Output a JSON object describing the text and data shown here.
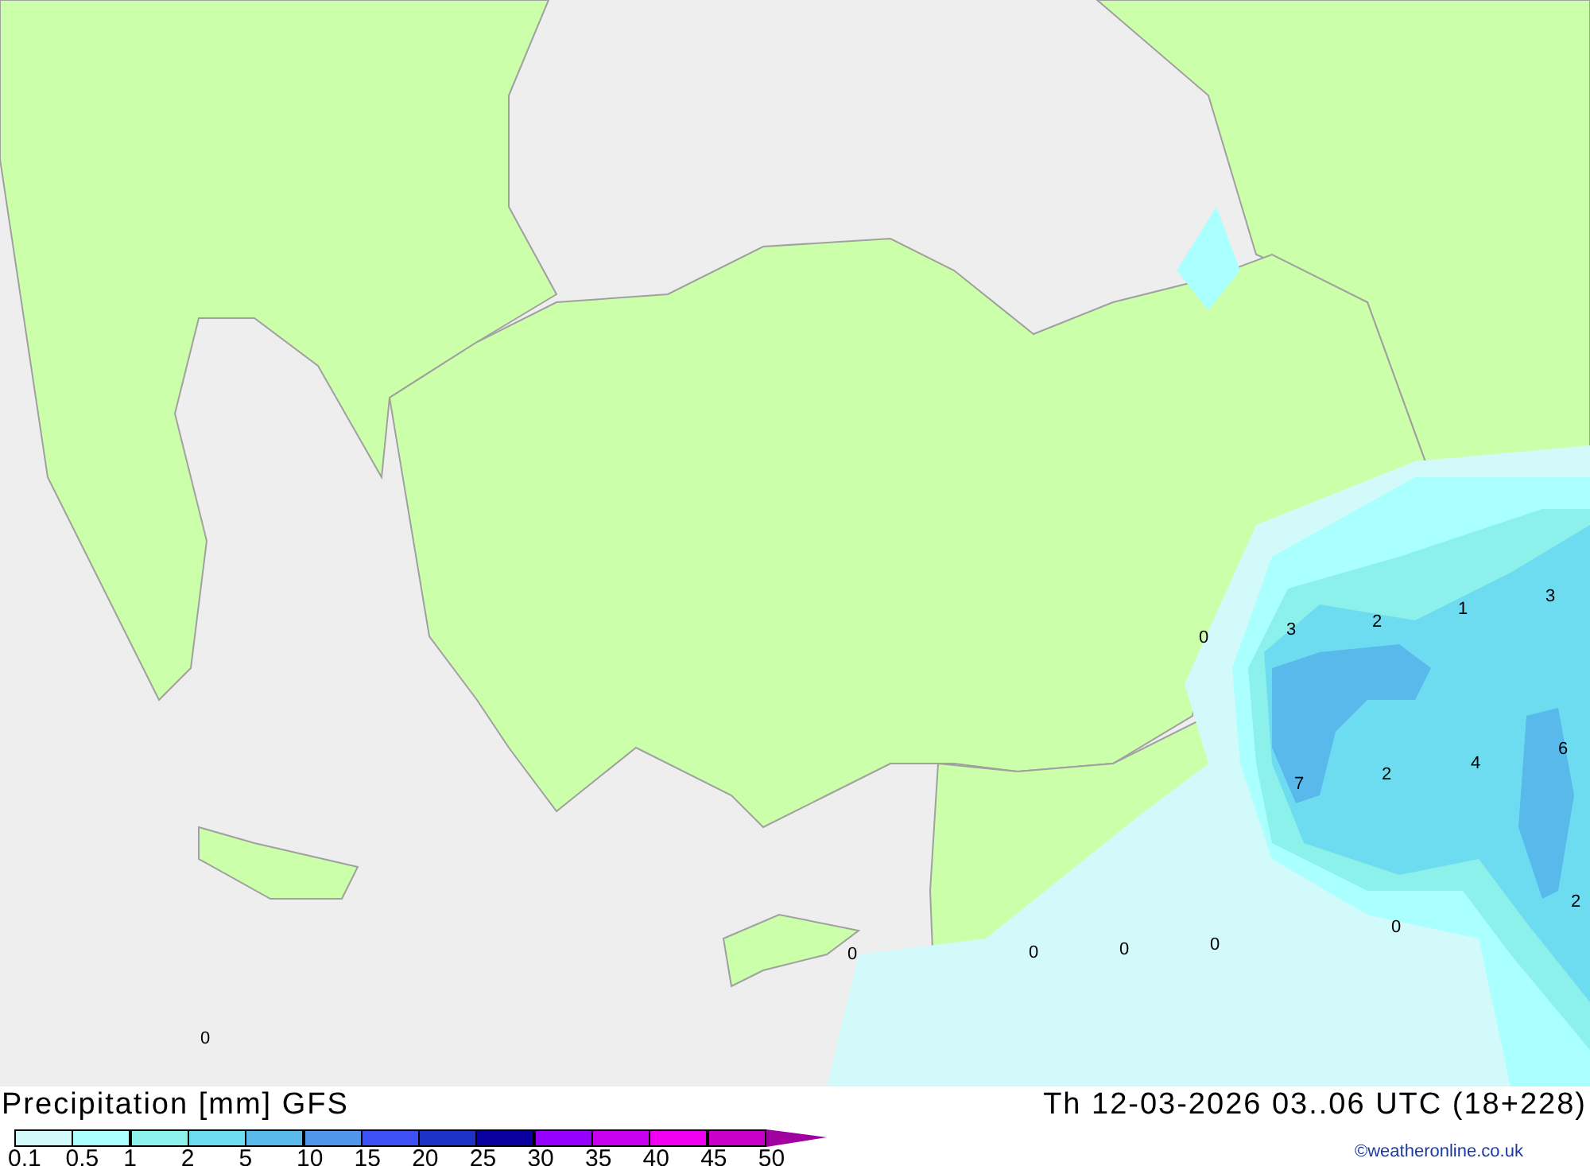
{
  "map": {
    "value_labels": [
      "0",
      "3",
      "2",
      "1",
      "3",
      "6",
      "7",
      "2",
      "4",
      "2",
      "0",
      "0",
      "0",
      "0",
      "0",
      "0"
    ]
  },
  "title": "Precipitation [mm] GFS",
  "valid_time": "Th 12-03-2026 03..06 UTC (18+228)",
  "legend": [
    {
      "label": "0.1",
      "color": "#d2fafa"
    },
    {
      "label": "0.5",
      "color": "#aaffff"
    },
    {
      "label": "1",
      "color": "#8cf0eb"
    },
    {
      "label": "2",
      "color": "#6edcf0"
    },
    {
      "label": "5",
      "color": "#5ab9eb"
    },
    {
      "label": "10",
      "color": "#5096eb"
    },
    {
      "label": "15",
      "color": "#3c50f5"
    },
    {
      "label": "20",
      "color": "#1e32c8"
    },
    {
      "label": "25",
      "color": "#0a00a0"
    },
    {
      "label": "30",
      "color": "#9600ff"
    },
    {
      "label": "35",
      "color": "#c800f0"
    },
    {
      "label": "40",
      "color": "#f000f0"
    },
    {
      "label": "45",
      "color": "#c800c8"
    },
    {
      "label": "50",
      "color": "#a000a0"
    }
  ],
  "credit": "©weatheronline.co.uk"
}
